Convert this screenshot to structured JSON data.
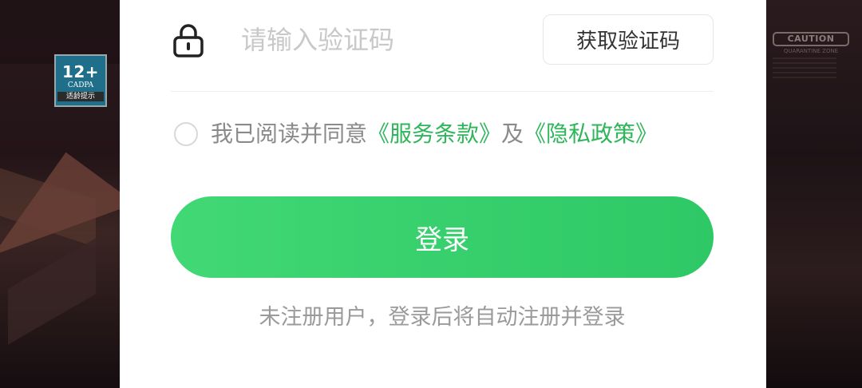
{
  "age_rating": {
    "number": "12+",
    "org": "CADPA",
    "label": "适龄提示"
  },
  "background_sign": {
    "title": "CAUTION",
    "subtitle": "QUARANTINE ZONE"
  },
  "form": {
    "code_placeholder": "请输入验证码",
    "code_value": "",
    "get_code_label": "获取验证码",
    "lock_icon": "lock-icon"
  },
  "agreement": {
    "checked": false,
    "prefix": "我已阅读并同意",
    "terms_link": "《服务条款》",
    "conjunction": "及",
    "privacy_link": "《隐私政策》"
  },
  "login": {
    "button_label": "登录",
    "hint": "未注册用户，登录后将自动注册并登录"
  },
  "colors": {
    "accent_green": "#2fb55a",
    "button_green": "#3ad16e"
  }
}
